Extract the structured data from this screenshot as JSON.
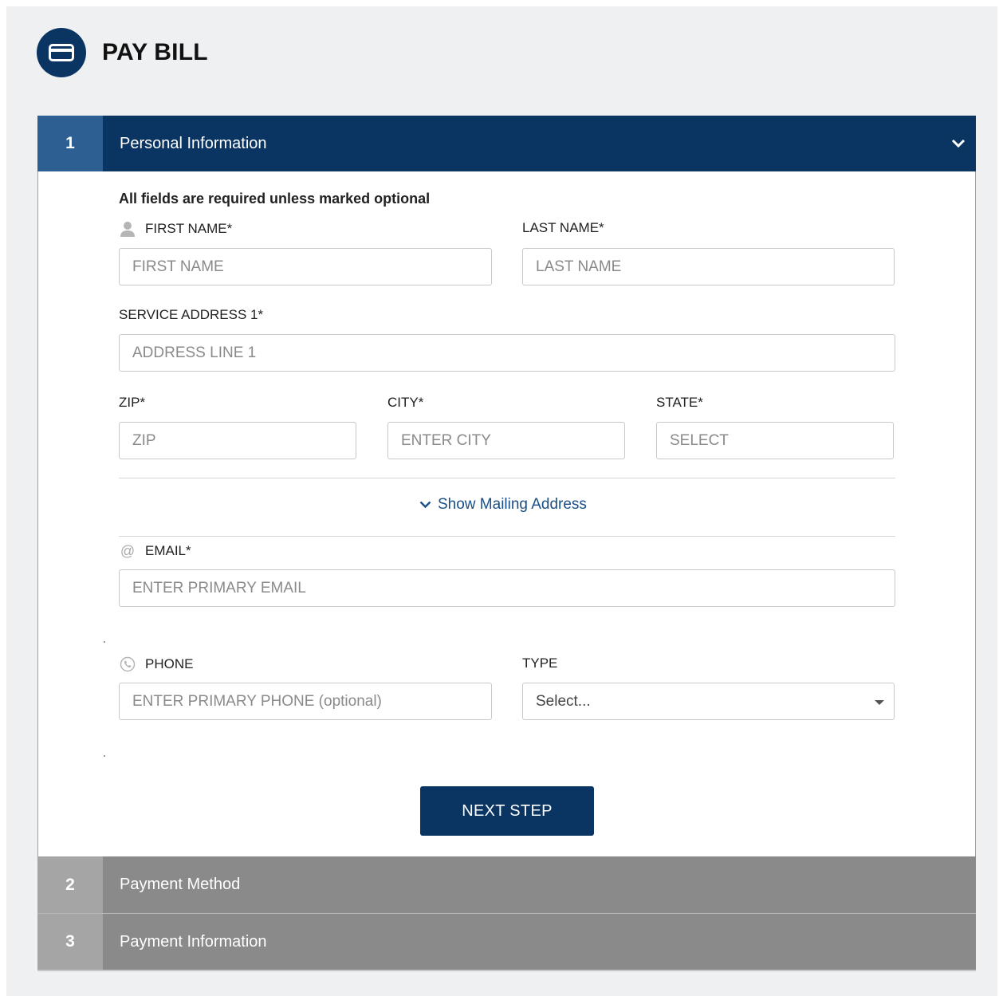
{
  "header": {
    "title": "PAY BILL",
    "icon": "credit-card-icon"
  },
  "steps": [
    {
      "number": "1",
      "title": "Personal Information"
    },
    {
      "number": "2",
      "title": "Payment Method"
    },
    {
      "number": "3",
      "title": "Payment Information"
    }
  ],
  "form": {
    "note": "All fields are required unless marked optional",
    "first_name": {
      "label": "FIRST NAME*",
      "placeholder": "FIRST NAME"
    },
    "last_name": {
      "label": "LAST NAME*",
      "placeholder": "LAST NAME"
    },
    "address1": {
      "label": "SERVICE ADDRESS 1*",
      "placeholder": "ADDRESS LINE 1"
    },
    "zip": {
      "label": "ZIP*",
      "placeholder": "ZIP"
    },
    "city": {
      "label": "CITY*",
      "placeholder": "ENTER CITY"
    },
    "state": {
      "label": "STATE*",
      "placeholder": "SELECT"
    },
    "show_mailing": "Show Mailing Address",
    "email": {
      "label": "EMAIL*",
      "placeholder": "ENTER PRIMARY EMAIL"
    },
    "phone": {
      "label": "PHONE",
      "placeholder": "ENTER PRIMARY PHONE (optional)"
    },
    "type": {
      "label": "TYPE",
      "value": "Select..."
    },
    "next_button": "NEXT STEP"
  },
  "colors": {
    "primary": "#0a3563",
    "step_active_num": "#2d5f92",
    "step_inactive": "#8a8a8a",
    "link": "#1a4f86"
  }
}
